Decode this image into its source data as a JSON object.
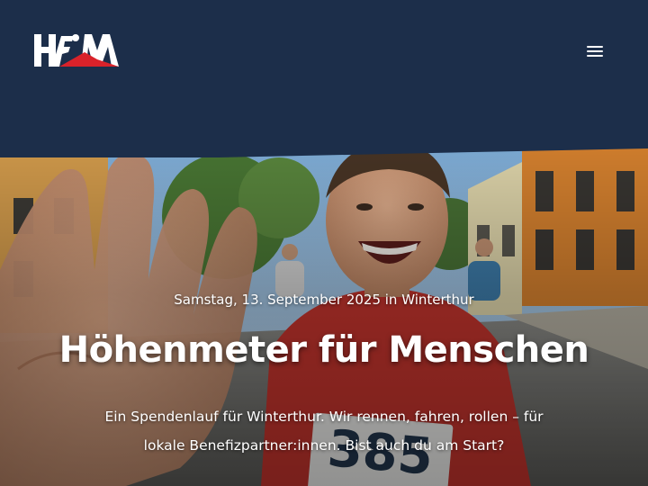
{
  "brand": {
    "logo_text": "HFM",
    "accent": "#d9222a",
    "navy": "#1c2e4a"
  },
  "header": {
    "menu_icon": "hamburger-menu-icon"
  },
  "hero": {
    "date_line": "Samstag, 13. September 2025 in Winterthur",
    "title": "Höhenmeter für Menschen",
    "description": "Ein Spendenlauf für Winterthur. Wir rennen, fahren, rollen – für lokale Benefizpartner:innen. Bist auch du am Start?",
    "bib_number": "385"
  }
}
